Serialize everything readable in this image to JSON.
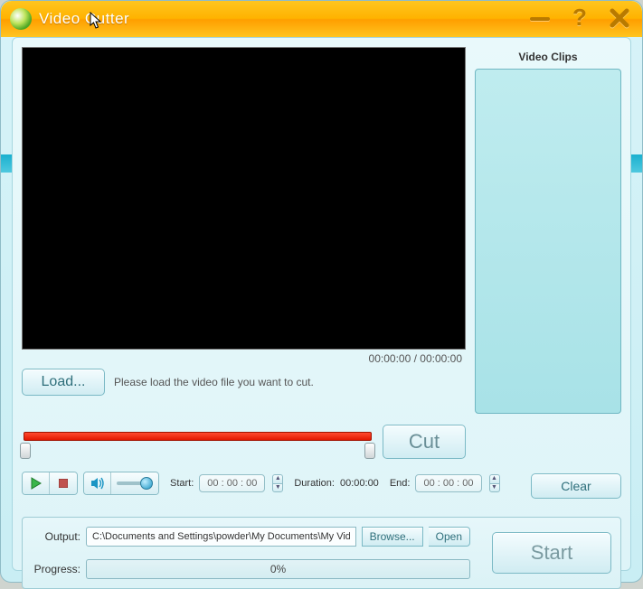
{
  "app": {
    "title": "Video Cutter"
  },
  "video": {
    "time_current": "00:00:00",
    "time_total": "00:00:00",
    "time_sep": " / "
  },
  "load": {
    "button": "Load...",
    "hint": "Please load the video file you want to cut."
  },
  "clips": {
    "title": "Video Clips"
  },
  "cut": {
    "button": "Cut"
  },
  "controls": {
    "start_label": "Start:",
    "start_value": "00 : 00 : 00",
    "duration_label": "Duration:",
    "duration_value": "00:00:00",
    "end_label": "End:",
    "end_value": "00 : 00 : 00"
  },
  "clear": {
    "button": "Clear"
  },
  "output": {
    "label": "Output:",
    "path": "C:\\Documents and Settings\\powder\\My Documents\\My Videos\\",
    "browse": "Browse...",
    "open": "Open"
  },
  "progress": {
    "label": "Progress:",
    "value": "0%"
  },
  "start": {
    "button": "Start"
  }
}
